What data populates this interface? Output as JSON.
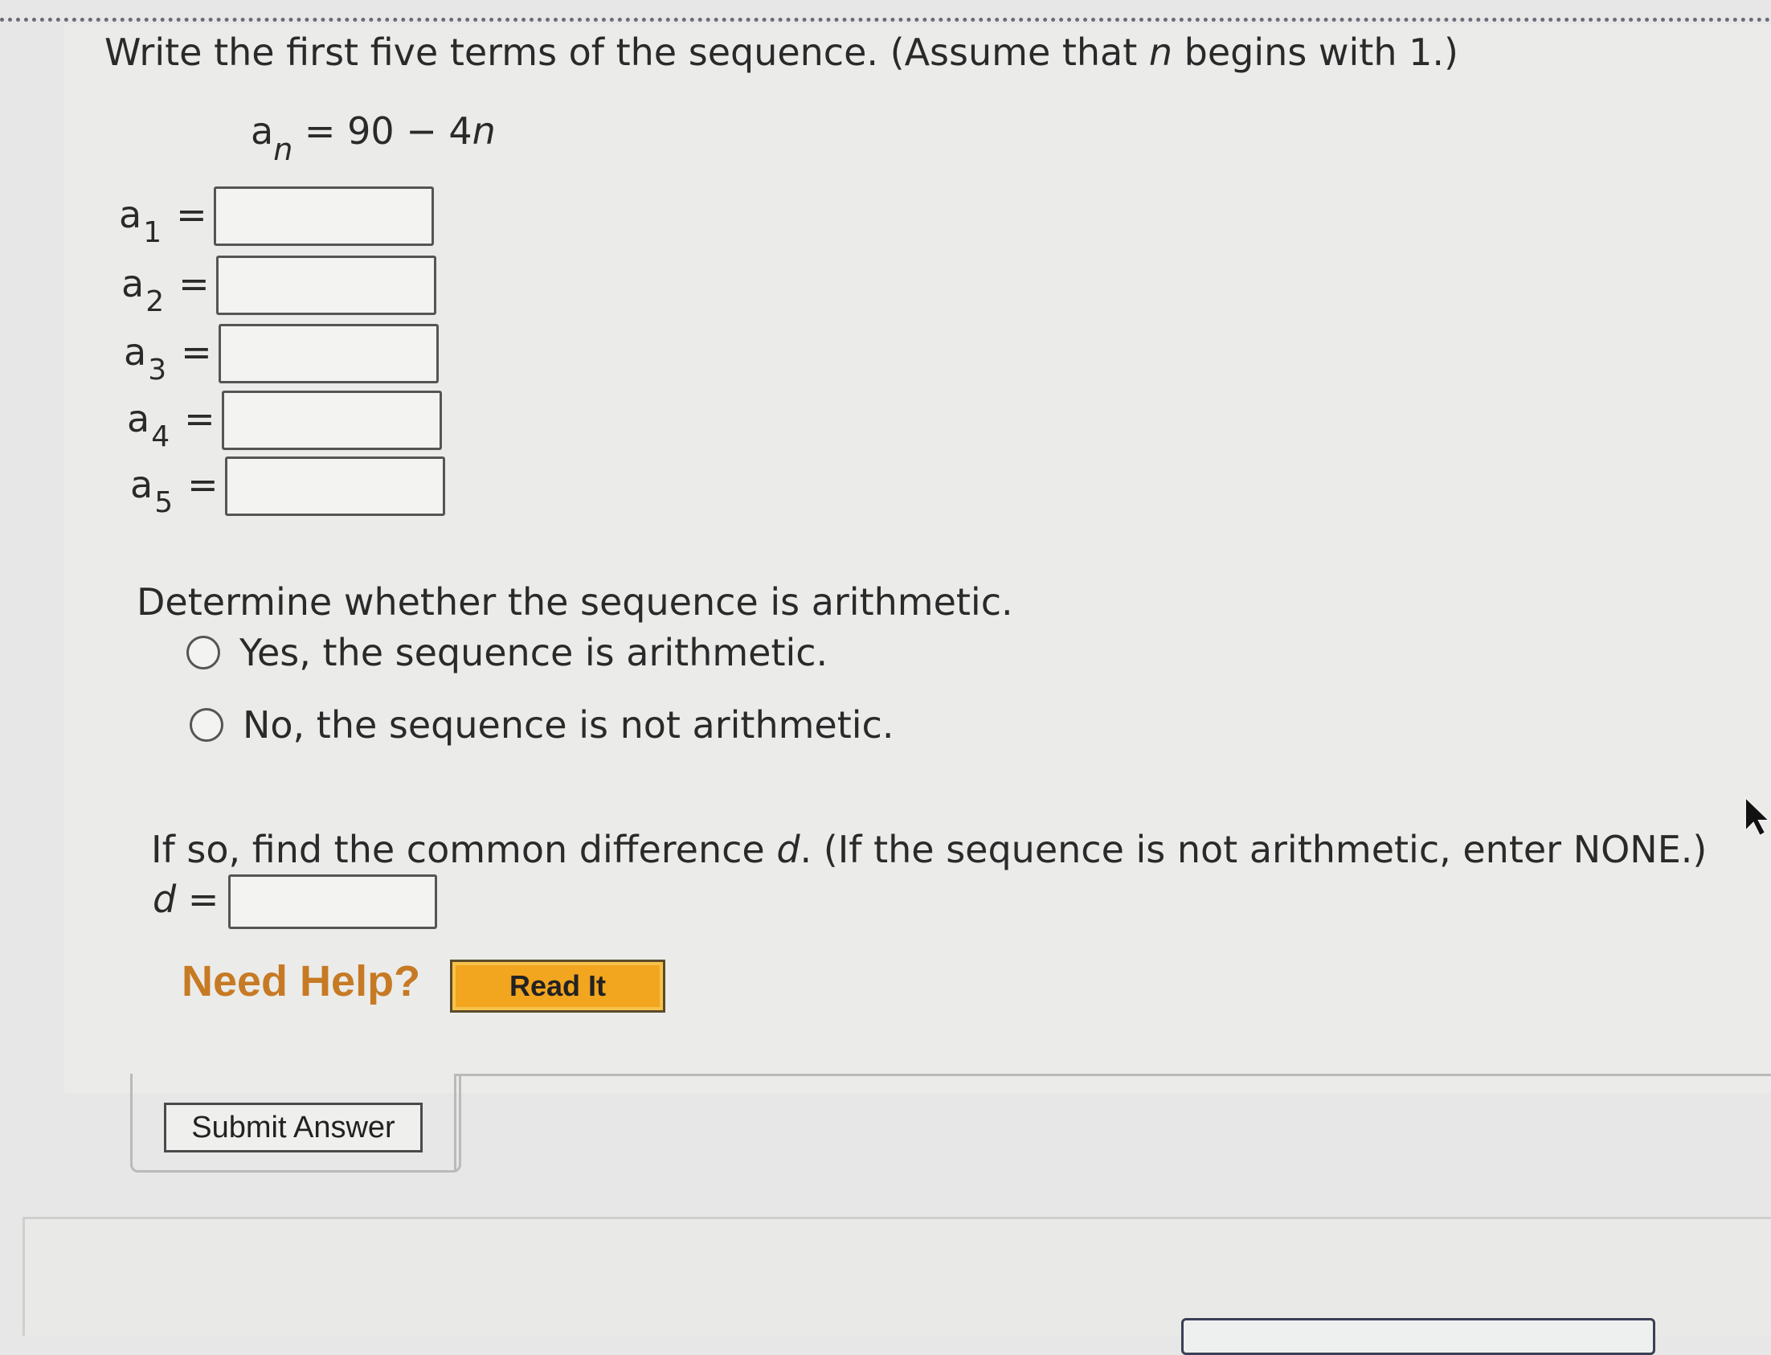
{
  "question": {
    "text_before": "Write the first five terms of the sequence. (Assume that ",
    "variable": "n",
    "text_after": " begins with 1.)"
  },
  "formula": {
    "lhs_base": "a",
    "lhs_sub": "n",
    "rhs_prefix": " = 90 − 4",
    "rhs_var": "n"
  },
  "terms": [
    {
      "base": "a",
      "sub": "1",
      "eq": "=",
      "value": ""
    },
    {
      "base": "a",
      "sub": "2",
      "eq": "=",
      "value": ""
    },
    {
      "base": "a",
      "sub": "3",
      "eq": "=",
      "value": ""
    },
    {
      "base": "a",
      "sub": "4",
      "eq": "=",
      "value": ""
    },
    {
      "base": "a",
      "sub": "5",
      "eq": "=",
      "value": ""
    }
  ],
  "arithmetic": {
    "title": "Determine whether the sequence is arithmetic.",
    "options": [
      {
        "label": "Yes, the sequence is arithmetic.",
        "selected": false
      },
      {
        "label": "No, the sequence is not arithmetic.",
        "selected": false
      }
    ]
  },
  "difference": {
    "prompt_before": "If so, find the common difference ",
    "prompt_var": "d",
    "prompt_after": ". (If the sequence is not arithmetic, enter NONE.)",
    "label_var": "d",
    "label_eq": " =",
    "value": ""
  },
  "help": {
    "need_help": "Need Help?",
    "read_it": "Read It"
  },
  "submit_label": "Submit Answer",
  "colors": {
    "need_help": "#c77a24",
    "read_it_bg": "#f2a51f"
  }
}
